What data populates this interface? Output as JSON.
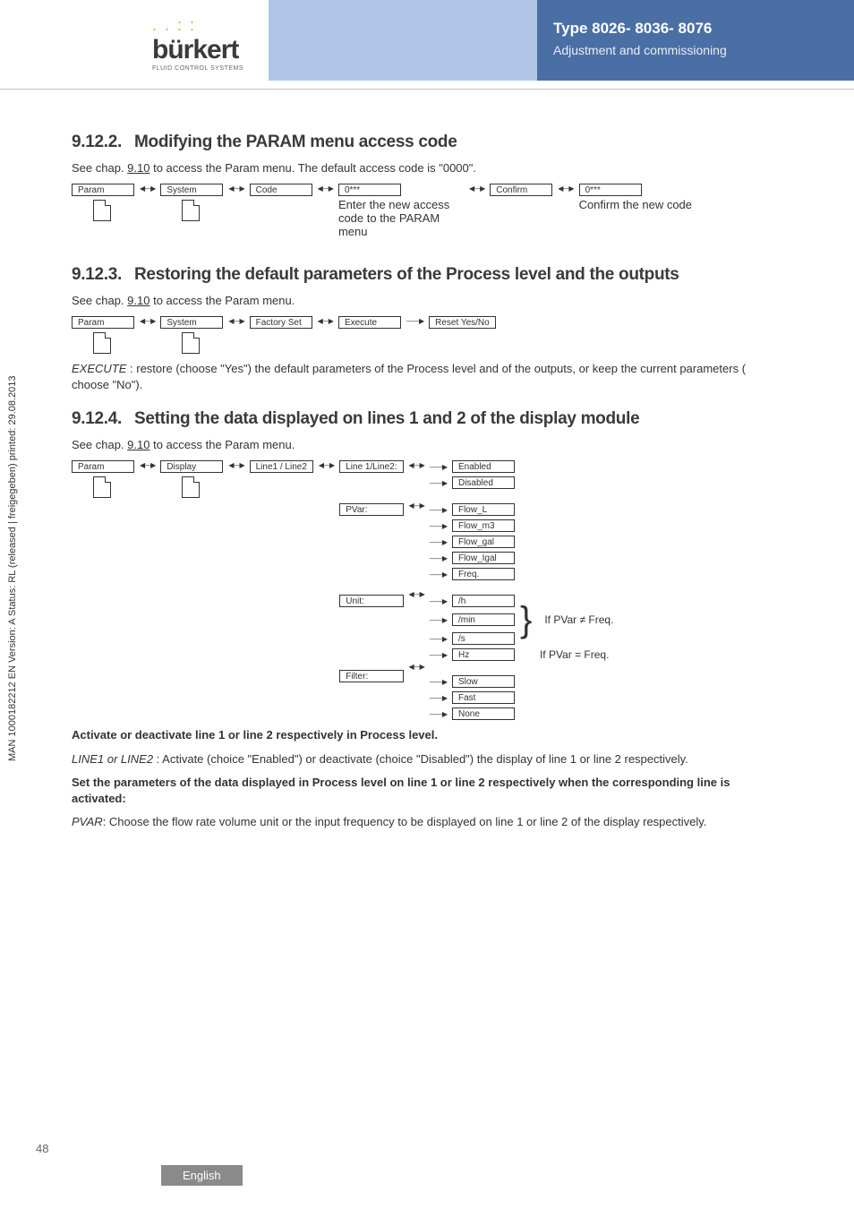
{
  "header": {
    "type_line": "Type 8026- 8036- 8076",
    "sub_line": "Adjustment and commissioning",
    "logo_dots": ". . : :",
    "logo_text": "bürkert",
    "logo_sub": "FLUID CONTROL SYSTEMS"
  },
  "vtext": "MAN 1000182212 EN Version: A Status: RL (released | freigegeben) printed: 29.08.2013",
  "s1": {
    "num": "9.12.2.",
    "title": "Modifying the PARAM menu access code",
    "see": "See chap. ",
    "see_u": "9.10",
    "see_tail": " to access the Param menu. The default access code is \"0000\".",
    "nodes": {
      "param": "Param",
      "system": "System",
      "code": "Code",
      "zero1": "0***",
      "confirm": "Confirm",
      "zero2": "0***"
    },
    "cap1": "Enter the new access code to the PARAM menu",
    "cap2": "Confirm the new code"
  },
  "s2": {
    "num": "9.12.3.",
    "title": "Restoring the default parameters of the Process level and the outputs",
    "see": "See chap. ",
    "see_u": "9.10",
    "see_tail": " to access the Param menu.",
    "nodes": {
      "param": "Param",
      "system": "System",
      "factory": "Factory Set",
      "execute": "Execute",
      "reset": "Reset Yes/No"
    },
    "body_i": "EXECUTE",
    "body": " : restore (choose \"Yes\") the default parameters of the Process level and of the outputs, or keep the current parameters ( choose \"No\")."
  },
  "s3": {
    "num": "9.12.4.",
    "title": "Setting the data displayed on lines 1 and 2 of the display module",
    "see": "See chap. ",
    "see_u": "9.10",
    "see_tail": " to access the Param menu.",
    "nodes": {
      "param": "Param",
      "display": "Display",
      "line12": "Line1 / Line2",
      "line12b": "Line 1/Line2:",
      "enabled": "Enabled",
      "disabled": "Disabled",
      "pvar": "PVar:",
      "flow_l": "Flow_L",
      "flow_m3": "Flow_m3",
      "flow_gal": "Flow_gal",
      "flow_igal": "Flow_Igal",
      "freq": "Freq.",
      "unit": "Unit:",
      "h": "/h",
      "min": "/min",
      "s": "/s",
      "hz": "Hz",
      "filter": "Filter:",
      "slow": "Slow",
      "fast": "Fast",
      "none": "None"
    },
    "note1": "If PVar ≠ Freq.",
    "note2": "If PVar = Freq.",
    "b1_bold": "Activate or deactivate line 1 or line 2 respectively in Process level.",
    "b2_i": "LINE1 or LINE2",
    "b2": " : Activate (choice \"Enabled\") or deactivate (choice \"Disabled\") the display of line 1 or line 2 respectively.",
    "b3_bold": "Set the parameters of the data displayed in Process level on line 1 or line 2 respectively when the corresponding line is activated:",
    "b4_i": "PVAR",
    "b4": ": Choose the flow rate volume unit or the input frequency to be displayed on line 1 or line 2 of the display respectively."
  },
  "page_num": "48",
  "footer": "English"
}
